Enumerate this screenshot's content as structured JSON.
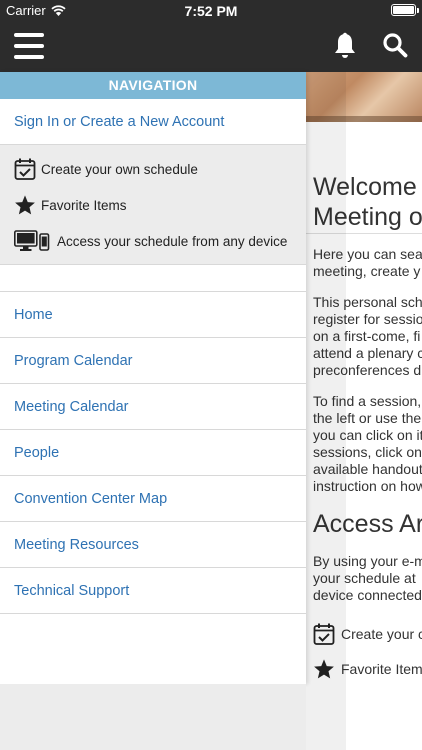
{
  "status_bar": {
    "carrier": "Carrier",
    "time": "7:52 PM",
    "battery_level": 1.0
  },
  "app_bar": {
    "menu_icon": "hamburger-icon",
    "notifications_icon": "bell-icon",
    "search_icon": "search-icon"
  },
  "drawer": {
    "header": "NAVIGATION",
    "sign_in": "Sign In or Create a New Account",
    "features": [
      {
        "icon": "calendar-check-icon",
        "label": "Create your own schedule"
      },
      {
        "icon": "star-icon",
        "label": "Favorite Items"
      },
      {
        "icon": "devices-icon",
        "label": "Access your schedule from any device"
      }
    ],
    "menu": [
      {
        "label": "Home"
      },
      {
        "label": "Program Calendar"
      },
      {
        "label": "Meeting Calendar"
      },
      {
        "label": "People"
      },
      {
        "label": "Convention Center Map"
      },
      {
        "label": "Meeting Resources"
      },
      {
        "label": "Technical Support"
      }
    ]
  },
  "main": {
    "title_line1": "Welcome",
    "title_line2": "Meeting o",
    "paragraphs": [
      [
        "Here you can sea",
        "meeting, create y"
      ],
      [
        "This personal sch",
        "register for sessio",
        "on a first-come, fi",
        "attend a plenary c",
        "preconferences d"
      ],
      [
        "To find a session,",
        "the left or use the",
        "you can click on it",
        "sessions, click on",
        "available handout",
        "instruction on how"
      ]
    ],
    "heading2": "Access Ar",
    "paragraph4": [
      "By using your e-m",
      "your schedule at",
      "device connected"
    ],
    "features": [
      {
        "icon": "calendar-check-icon",
        "label": "Create your c"
      },
      {
        "icon": "star-icon",
        "label": "Favorite Item"
      }
    ]
  },
  "colors": {
    "nav_header": "#7db8d6",
    "link": "#2e72b3",
    "app_bar": "#2c2c2c"
  }
}
